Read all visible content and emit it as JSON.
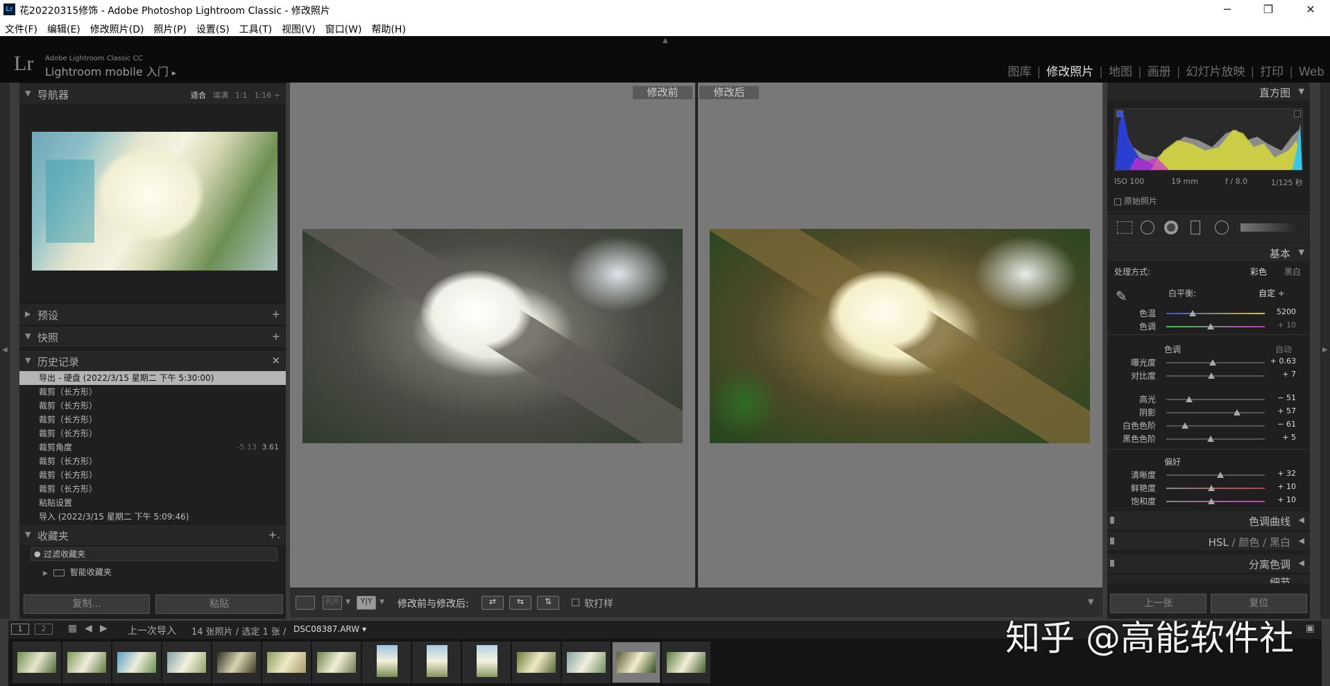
{
  "window": {
    "title": "花20220315修饰 - Adobe Photoshop Lightroom Classic - 修改照片",
    "minimize": "─",
    "restore": "❐",
    "close": "✕",
    "app_icon": "Lr"
  },
  "menu": [
    "文件(F)",
    "编辑(E)",
    "修改照片(D)",
    "照片(P)",
    "设置(S)",
    "工具(T)",
    "视图(V)",
    "窗口(W)",
    "帮助(H)"
  ],
  "identity": {
    "logo": "Lr",
    "line1": "Adobe Lightroom Classic CC",
    "line2": "Lightroom mobile 入门",
    "arrow": "▸"
  },
  "modules": [
    "图库",
    "修改照片",
    "地图",
    "画册",
    "幻灯片放映",
    "打印",
    "Web"
  ],
  "left": {
    "navigator": {
      "title": "导航器",
      "opts": [
        "适合",
        "填满",
        "1:1",
        "1:16 ÷"
      ]
    },
    "presets": {
      "title": "预设",
      "action": "+"
    },
    "snapshots": {
      "title": "快照",
      "action": "+"
    },
    "history": {
      "title": "历史记录",
      "action": "✕",
      "items": [
        {
          "label": "导出 - 硬盘 (2022/3/15 星期二 下午 5:30:00)",
          "a": "",
          "b": ""
        },
        {
          "label": "裁剪（长方形）",
          "a": "",
          "b": ""
        },
        {
          "label": "裁剪（长方形）",
          "a": "",
          "b": ""
        },
        {
          "label": "裁剪（长方形）",
          "a": "",
          "b": ""
        },
        {
          "label": "裁剪（长方形）",
          "a": "",
          "b": ""
        },
        {
          "label": "裁剪角度",
          "a": "-5.13",
          "b": "3.61"
        },
        {
          "label": "裁剪（长方形）",
          "a": "",
          "b": ""
        },
        {
          "label": "裁剪（长方形）",
          "a": "",
          "b": ""
        },
        {
          "label": "裁剪（长方形）",
          "a": "",
          "b": ""
        },
        {
          "label": "粘贴设置",
          "a": "",
          "b": ""
        },
        {
          "label": "导入 (2022/3/15 星期二 下午 5:09:46)",
          "a": "",
          "b": ""
        }
      ]
    },
    "collections": {
      "title": "收藏夹",
      "action": "+.",
      "filter": "过滤收藏夹",
      "smart": "智能收藏夹"
    },
    "copy_btn": "复制...",
    "paste_btn": "粘贴"
  },
  "center": {
    "before": "修改前",
    "after": "修改后",
    "toolbar_label": "修改前与修改后:",
    "softproof": "软打样",
    "yy": "Y|Y",
    "rr": "R|R"
  },
  "right": {
    "histogram": {
      "title": "直方图",
      "iso": "ISO 100",
      "focal": "19 mm",
      "aperture": "f / 8.0",
      "shutter": "1/125 秒",
      "original": "原始照片"
    },
    "basic": {
      "title": "基本",
      "treatment_label": "处理方式:",
      "color": "彩色",
      "bw": "黑白",
      "wb_label": "白平衡:",
      "wb_value": "自定 ÷",
      "tone_label": "色调",
      "auto": "自动",
      "presence": "偏好",
      "sliders": [
        {
          "name": "色温",
          "value": "5200",
          "pos": 0.27
        },
        {
          "name": "色调",
          "value": "+ 10",
          "pos": 0.45
        },
        {
          "name": "曝光度",
          "value": "+ 0.63",
          "pos": 0.47
        },
        {
          "name": "对比度",
          "value": "+ 7",
          "pos": 0.46
        },
        {
          "name": "高光",
          "value": "− 51",
          "pos": 0.23
        },
        {
          "name": "阴影",
          "value": "+ 57",
          "pos": 0.72
        },
        {
          "name": "白色色阶",
          "value": "− 61",
          "pos": 0.19
        },
        {
          "name": "黑色色阶",
          "value": "+ 5",
          "pos": 0.45
        },
        {
          "name": "清晰度",
          "value": "+ 32",
          "pos": 0.55
        },
        {
          "name": "鲜艳度",
          "value": "+ 10",
          "pos": 0.46
        },
        {
          "name": "饱和度",
          "value": "+ 10",
          "pos": 0.46
        }
      ]
    },
    "tone_curve": "色调曲线",
    "hsl": "HSL",
    "hsl_color": "颜色",
    "hsl_bw": "黑白",
    "split": "分离色调",
    "detail": "细节",
    "prev_btn": "上一张",
    "reset_btn": "复位"
  },
  "filmstrip": {
    "view1": "1",
    "view2": "2",
    "source": "上一次导入",
    "count": "14 张照片 / 选定 1 张 /",
    "file": "DSC08387.ARW"
  },
  "watermark": "知乎 @高能软件社"
}
